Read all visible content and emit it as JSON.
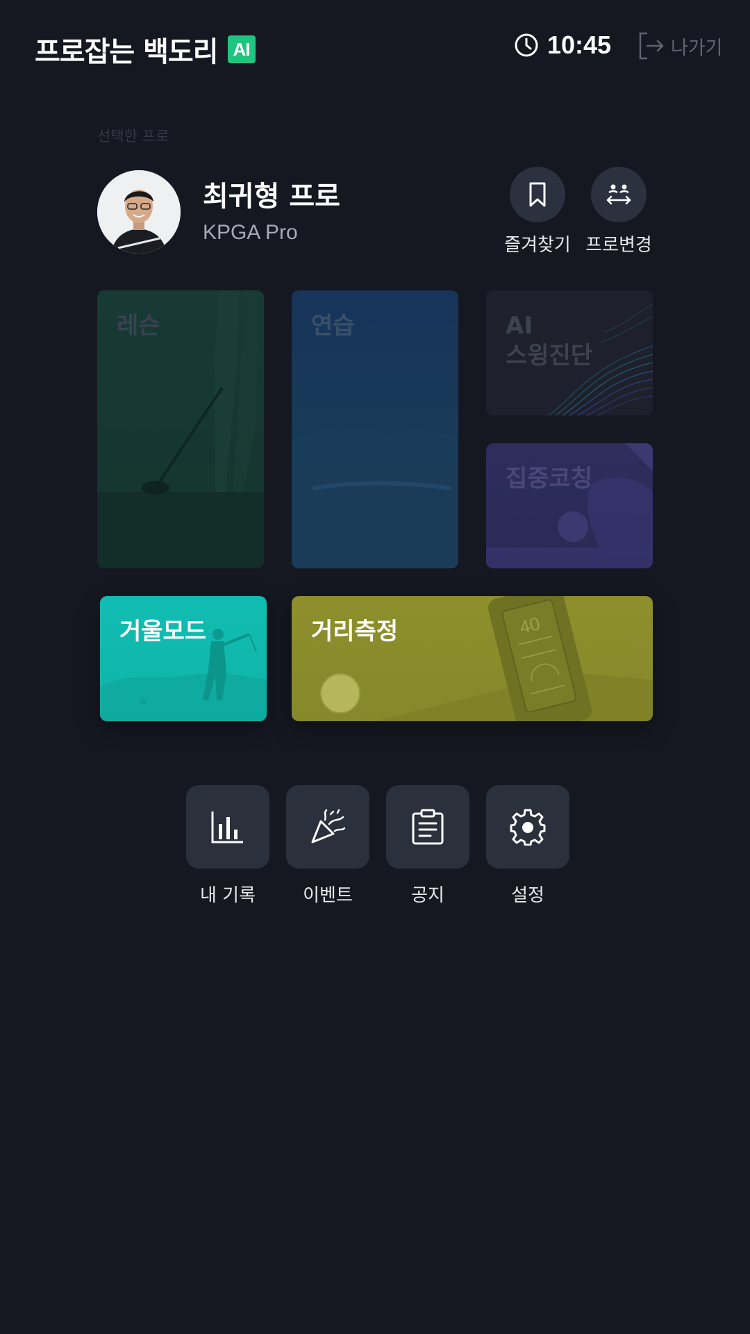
{
  "header": {
    "app_title": "프로잡는 백도리",
    "ai_badge": "AI",
    "clock_time": "10:45",
    "exit_label": "나가기"
  },
  "profile": {
    "section_label": "선택한 프로",
    "name": "최귀형 프로",
    "tour": "KPGA Pro",
    "actions": [
      {
        "label": "즐겨찾기",
        "icon": "bookmark-icon"
      },
      {
        "label": "프로변경",
        "icon": "swap-pro-icon"
      }
    ]
  },
  "tiles": {
    "lesson": "레슨",
    "practice": "연습",
    "ai_swing": "AI\n스윙진단",
    "focus_coaching": "집중코칭",
    "mirror_mode": "거울모드",
    "distance": "거리측정"
  },
  "menu": [
    {
      "label": "내 기록",
      "icon": "bar-chart-icon"
    },
    {
      "label": "이벤트",
      "icon": "party-popper-icon"
    },
    {
      "label": "공지",
      "icon": "clipboard-icon"
    },
    {
      "label": "설정",
      "icon": "gear-icon"
    }
  ],
  "colors": {
    "background": "#151821",
    "ai_badge": "#1fc57e",
    "mirror_tile": "#11bdb2",
    "distance_tile": "#8e8f2c"
  }
}
